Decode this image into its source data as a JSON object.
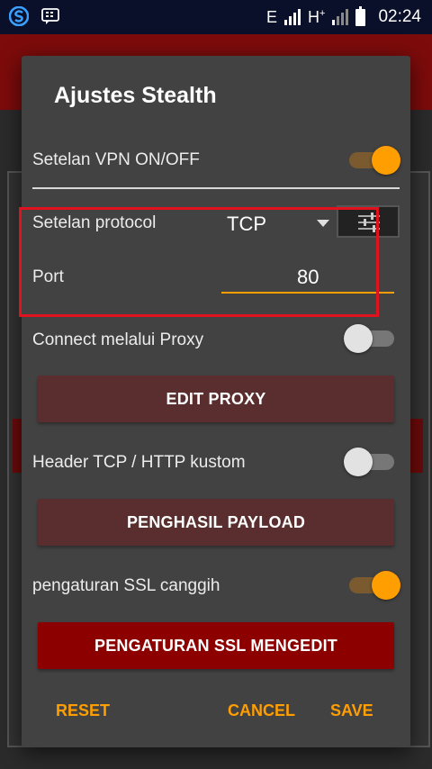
{
  "status_bar": {
    "network_type_1": "E",
    "network_type_2": "H",
    "network_type_2_sup": "+",
    "time": "02:24",
    "icons": [
      "s-app-icon",
      "bbm-icon",
      "signal-icon",
      "battery-icon"
    ]
  },
  "dialog": {
    "title": "Ajustes Stealth",
    "vpn_switch": {
      "label": "Setelan VPN ON/OFF",
      "on": true
    },
    "protocol": {
      "label": "Setelan protocol",
      "value": "TCP"
    },
    "port": {
      "label": "Port",
      "value": "80"
    },
    "proxy_switch": {
      "label": "Connect melalui Proxy",
      "on": false
    },
    "edit_proxy_button": "EDIT PROXY",
    "header_switch": {
      "label": "Header TCP / HTTP kustom",
      "on": false
    },
    "payload_button": "PENGHASIL PAYLOAD",
    "ssl_switch": {
      "label": "pengaturan SSL canggih",
      "on": true
    },
    "ssl_edit_button": "PENGATURAN SSL MENGEDIT",
    "actions": {
      "reset": "RESET",
      "cancel": "CANCEL",
      "save": "SAVE"
    }
  },
  "colors": {
    "accent": "#ff9e00",
    "primary_button": "#8c0000",
    "muted_button": "#5a2e2e",
    "highlight": "#e0121e",
    "dialog_bg": "#424242"
  }
}
